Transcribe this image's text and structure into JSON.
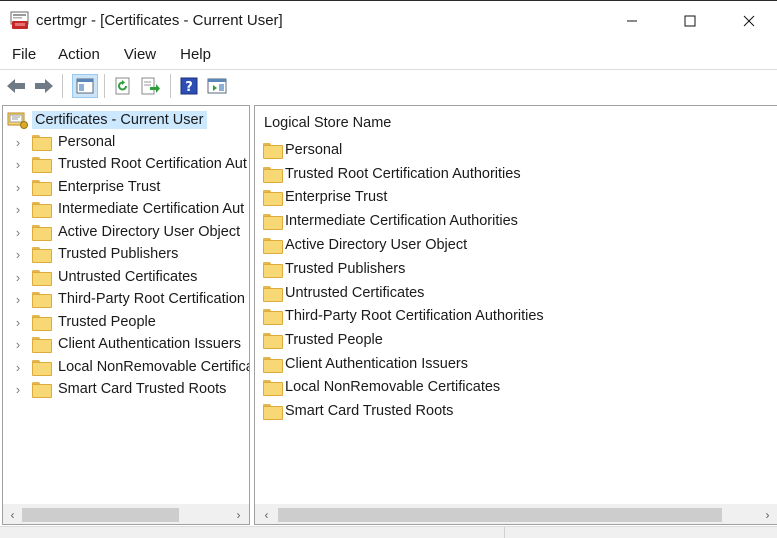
{
  "window": {
    "title": "certmgr - [Certificates - Current User]",
    "controls": {
      "minimize": "—",
      "maximize": "☐",
      "close": "✕"
    }
  },
  "menu": [
    "File",
    "Action",
    "View",
    "Help"
  ],
  "toolbar": {
    "icons": [
      "back-arrow-icon",
      "forward-arrow-icon",
      "show-hide-tree-icon",
      "refresh-icon",
      "export-list-icon",
      "help-icon",
      "action-pane-icon"
    ]
  },
  "tree": {
    "root": "Certificates - Current User",
    "items": [
      "Personal",
      "Trusted Root Certification Aut",
      "Enterprise Trust",
      "Intermediate Certification Aut",
      "Active Directory User Object",
      "Trusted Publishers",
      "Untrusted Certificates",
      "Third-Party Root Certification",
      "Trusted People",
      "Client Authentication Issuers",
      "Local NonRemovable Certifica",
      "Smart Card Trusted Roots"
    ]
  },
  "list": {
    "column_header": "Logical Store Name",
    "items": [
      "Personal",
      "Trusted Root Certification Authorities",
      "Enterprise Trust",
      "Intermediate Certification Authorities",
      "Active Directory User Object",
      "Trusted Publishers",
      "Untrusted Certificates",
      "Third-Party Root Certification Authorities",
      "Trusted People",
      "Client Authentication Issuers",
      "Local NonRemovable Certificates",
      "Smart Card Trusted Roots"
    ]
  },
  "glyphs": {
    "chevron": "›",
    "scroll_left": "‹",
    "scroll_right": "›"
  },
  "colors": {
    "selection": "#cce8ff",
    "folder": "#f8d775"
  }
}
